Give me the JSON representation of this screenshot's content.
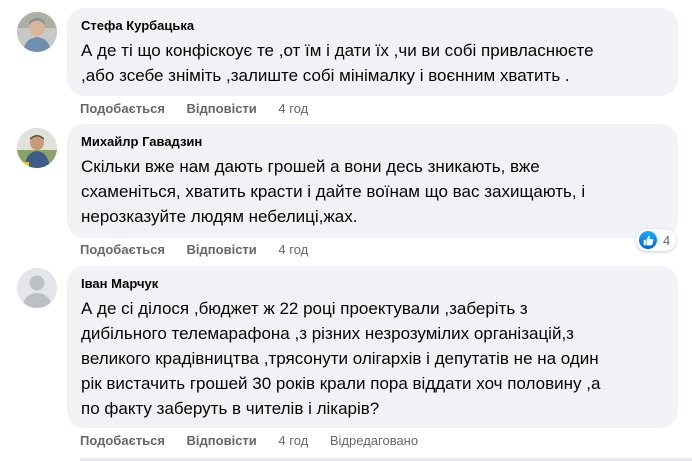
{
  "comments": [
    {
      "author": "Стефа Курбацька",
      "lines": [
        "А де ті що конфіскоує те ,от їм і дати їх ,чи ви собі привласнюєте",
        ",або зсебе зніміть ,залиште собі мінімалку і воєнним хватить ."
      ],
      "like_label": "Подобається",
      "reply_label": "Відповісти",
      "time": "4 год"
    },
    {
      "author": "Михайлр Гавадзин",
      "lines": [
        "Скільки вже нам дають грошей а вони десь зникають, вже",
        "схаменіться, хватить красти і дайте воїнам що вас захищають, і",
        "нерозказуйте людям небелиці,жах."
      ],
      "like_label": "Подобається",
      "reply_label": "Відповісти",
      "time": "4 год",
      "reactions": {
        "icon": "like-icon",
        "count": "4"
      }
    },
    {
      "author": "Іван Марчук",
      "lines": [
        "А де сі ділося ,бюджет ж 22 році проектували ,заберіть з",
        "дибільного телемарафона ,з різних незрозумілих організацій,з",
        "великого крадівництва ,трясонути олігархів і депутатів не на один",
        "рік вистачить грошей 30 років крали пора віддати хоч половину ,а",
        "по факту заберуть в чителів і лікарів?"
      ],
      "like_label": "Подобається",
      "reply_label": "Відповісти",
      "time": "4 год",
      "edited_label": "Відредаговано"
    }
  ],
  "colors": {
    "bubble": "#f0f2f5",
    "secondary_text": "#65676b",
    "like_blue": "#1877f2"
  }
}
